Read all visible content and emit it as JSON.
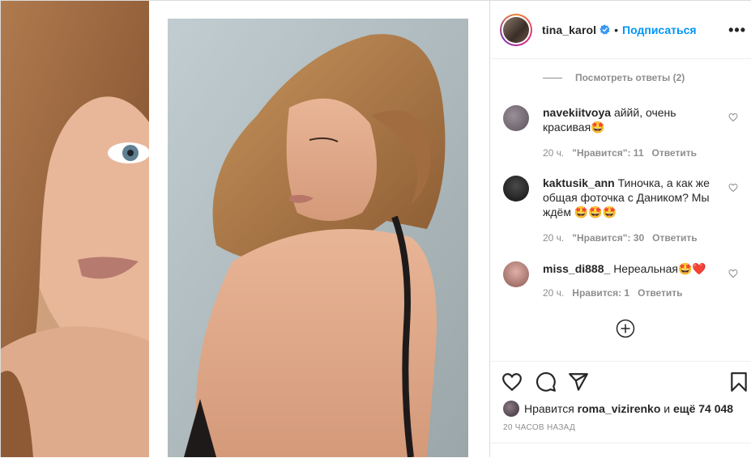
{
  "header": {
    "username": "tina_karol",
    "verified_icon": "verified-badge-icon",
    "separator": "•",
    "follow_label": "Подписаться",
    "more_label": "•••"
  },
  "comments": {
    "view_replies": "Посмотреть ответы (2)",
    "items": [
      {
        "user": "navekiitvoya",
        "text": "аййй, очень красивая🤩",
        "time": "20 ч.",
        "likes": "\"Нравится\": 11",
        "reply": "Ответить",
        "avatar_color": "#7a6f78"
      },
      {
        "user": "kaktusik_ann",
        "text": "Тиночка, а как же общая фоточка с Даником? Мы ждём 🤩🤩🤩",
        "time": "20 ч.",
        "likes": "\"Нравится\": 30",
        "reply": "Ответить",
        "avatar_color": "#2a2a2a"
      },
      {
        "user": "miss_di888_",
        "text": "Нереальная🤩❤️",
        "time": "20 ч.",
        "likes": "Нравится: 1",
        "reply": "Ответить",
        "avatar_color": "#c98a86"
      }
    ]
  },
  "footer": {
    "likes_prefix": "Нравится",
    "likes_user": "roma_vizirenko",
    "likes_and": "и",
    "likes_count": "ещё 74 048",
    "time_ago": "20 часов назад"
  },
  "colors": {
    "accent": "#0095f6",
    "text": "#262626",
    "muted": "#8e8e8e",
    "border": "#dbdbdb"
  }
}
